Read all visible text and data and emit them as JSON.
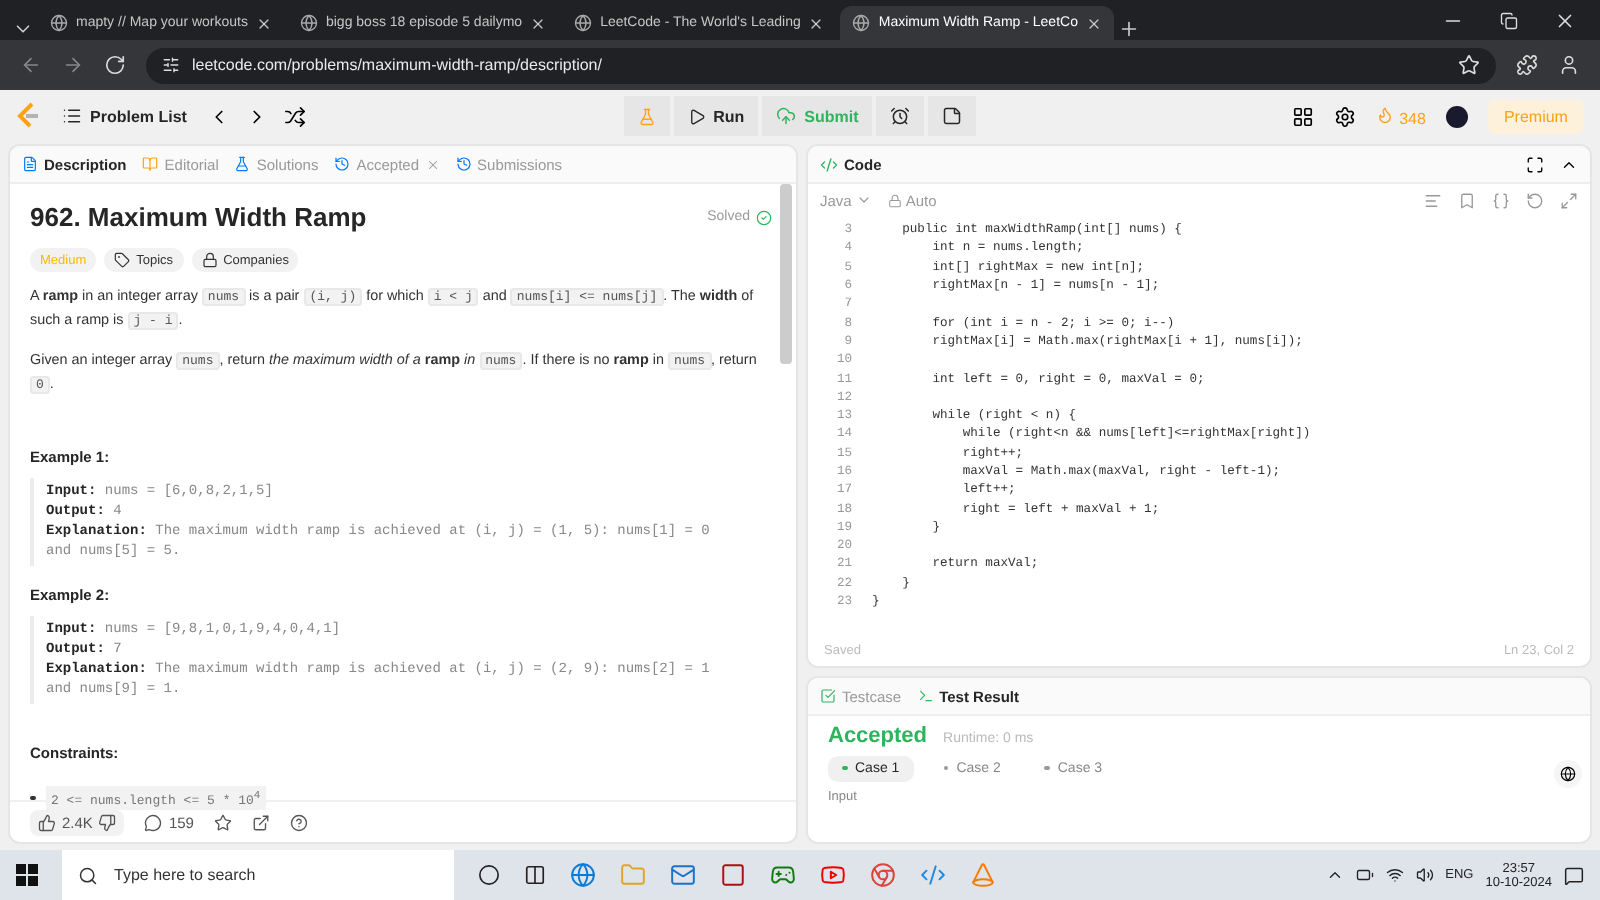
{
  "browser": {
    "tabs": [
      {
        "title": "mapty // Map your workouts",
        "selected": false
      },
      {
        "title": "bigg boss 18 episode 5 dailymo",
        "selected": false
      },
      {
        "title": "LeetCode - The World's Leading",
        "selected": false
      },
      {
        "title": "Maximum Width Ramp - LeetCo",
        "selected": true
      }
    ],
    "address": "leetcode.com/problems/maximum-width-ramp/description/"
  },
  "nav": {
    "problem_list": "Problem List",
    "run": "Run",
    "submit": "Submit",
    "streak": "348",
    "premium": "Premium"
  },
  "description": {
    "tabs": [
      {
        "label": "Description",
        "selected": true
      },
      {
        "label": "Editorial",
        "selected": false
      },
      {
        "label": "Solutions",
        "selected": false
      },
      {
        "label": "Accepted",
        "selected": false
      },
      {
        "label": "Submissions",
        "selected": false
      }
    ],
    "title": "962. Maximum Width Ramp",
    "status": "Solved",
    "tags": [
      {
        "kind": "difficulty",
        "label": "Medium"
      },
      {
        "kind": "topics",
        "label": "Topics"
      },
      {
        "kind": "companies",
        "label": "Companies"
      }
    ],
    "paragraphs": [
      [
        {
          "kind": "text",
          "text": "A **ramp** in an integer array "
        },
        {
          "kind": "code",
          "text": "nums"
        },
        {
          "kind": "text",
          "text": " is a pair "
        },
        {
          "kind": "code",
          "text": "(i, j)"
        },
        {
          "kind": "text",
          "text": " for which "
        },
        {
          "kind": "code",
          "text": "i < j"
        },
        {
          "kind": "text",
          "text": " and "
        },
        {
          "kind": "code",
          "text": "nums[i] <= nums[j]"
        },
        {
          "kind": "text",
          "text": ". The **width** of such a ramp is "
        },
        {
          "kind": "code",
          "text": "j - i"
        },
        {
          "kind": "text",
          "text": "."
        }
      ],
      [
        {
          "kind": "text",
          "text": "Given an integer array "
        },
        {
          "kind": "code",
          "text": "nums"
        },
        {
          "kind": "text",
          "text": ", return *the maximum width of a* **ramp** *in* "
        },
        {
          "kind": "code",
          "text": "nums"
        },
        {
          "kind": "text",
          "text": ". If there is no **ramp** in "
        },
        {
          "kind": "code",
          "text": "nums"
        },
        {
          "kind": "text",
          "text": ", return "
        },
        {
          "kind": "code",
          "text": "0"
        },
        {
          "kind": "text",
          "text": "."
        }
      ]
    ],
    "examples": [
      {
        "heading": "Example 1:",
        "lines": [
          {
            "label": "Input:",
            "value": "nums = [6,0,8,2,1,5]"
          },
          {
            "label": "Output:",
            "value": "4"
          },
          {
            "label": "Explanation:",
            "value": "The maximum width ramp is achieved at (i, j) = (1, 5): nums[1] = 0 and nums[5] = 5."
          }
        ]
      },
      {
        "heading": "Example 2:",
        "lines": [
          {
            "label": "Input:",
            "value": "nums = [9,8,1,0,1,9,4,0,4,1]"
          },
          {
            "label": "Output:",
            "value": "7"
          },
          {
            "label": "Explanation:",
            "value": "The maximum width ramp is achieved at (i, j) = (2, 9): nums[2] = 1 and nums[9] = 1."
          }
        ]
      }
    ],
    "constraints_heading": "Constraints:",
    "constraints": [
      "2 <= nums.length <= 5 * 10$^{4}$"
    ],
    "likes": "2.4K",
    "comments": "159"
  },
  "code": {
    "title": "Code",
    "language": "Java",
    "mode": "Auto",
    "lines": [
      {
        "no": "3",
        "text": "    public int maxWidthRamp(int[] nums) {"
      },
      {
        "no": "4",
        "text": "        int n = nums.length;"
      },
      {
        "no": "5",
        "text": "        int[] rightMax = new int[n];"
      },
      {
        "no": "6",
        "text": "        rightMax[n - 1] = nums[n - 1];"
      },
      {
        "no": "7"
      },
      {
        "no": "8",
        "text": "        for (int i = n - 2; i >= 0; i--)"
      },
      {
        "no": "9",
        "text": "        rightMax[i] = Math.max(rightMax[i + 1], nums[i]);"
      },
      {
        "no": "10"
      },
      {
        "no": "11",
        "text": "        int left = 0, right = 0, maxVal = 0;"
      },
      {
        "no": "12"
      },
      {
        "no": "13",
        "text": "        while (right < n) {"
      },
      {
        "no": "14",
        "text": "            while (right<n && nums[left]<=rightMax[right])"
      },
      {
        "no": "15",
        "text": "            right++;"
      },
      {
        "no": "16",
        "text": "            maxVal = Math.max(maxVal, right - left-1);"
      },
      {
        "no": "17",
        "text": "            left++;"
      },
      {
        "no": "18",
        "text": "            right = left + maxVal + 1;"
      },
      {
        "no": "19",
        "text": "        }"
      },
      {
        "no": "20"
      },
      {
        "no": "21",
        "text": "        return maxVal;"
      },
      {
        "no": "22",
        "text": "    }"
      },
      {
        "no": "23",
        "text": "}"
      }
    ],
    "saved": "Saved",
    "cursor": "Ln 23, Col 2"
  },
  "result": {
    "tabs": [
      {
        "label": "Testcase",
        "selected": false
      },
      {
        "label": "Test Result",
        "selected": true
      }
    ],
    "verdict": "Accepted",
    "runtime": "Runtime: 0 ms",
    "cases": [
      {
        "label": "Case 1",
        "selected": true
      },
      {
        "label": "Case 2",
        "selected": false
      },
      {
        "label": "Case 3",
        "selected": false
      }
    ],
    "input_label": "Input"
  },
  "taskbar": {
    "search_placeholder": "Type here to search",
    "language": "ENG",
    "time": "23:57",
    "date": "10-10-2024"
  }
}
